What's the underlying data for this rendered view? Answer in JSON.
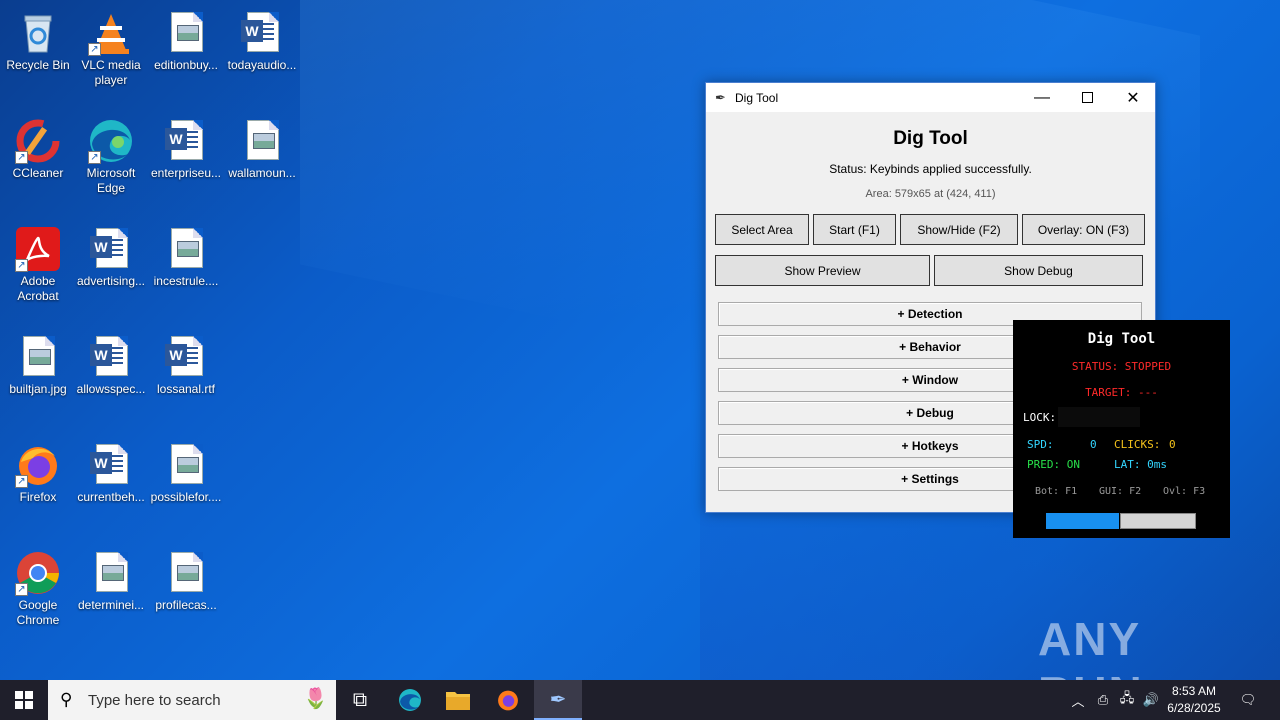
{
  "desktop_icons": [
    {
      "label": "Recycle Bin",
      "icon": "recycle-bin-icon"
    },
    {
      "label": "VLC media player",
      "icon": "vlc-icon"
    },
    {
      "label": "editionbuy...",
      "icon": "image-file-icon"
    },
    {
      "label": "todayaudio...",
      "icon": "word-document-icon"
    },
    {
      "label": "CCleaner",
      "icon": "ccleaner-icon"
    },
    {
      "label": "Microsoft Edge",
      "icon": "edge-icon"
    },
    {
      "label": "enterpriseu...",
      "icon": "word-document-icon"
    },
    {
      "label": "wallamoun...",
      "icon": "image-file-icon"
    },
    {
      "label": "Adobe Acrobat",
      "icon": "acrobat-icon"
    },
    {
      "label": "advertising...",
      "icon": "word-document-icon"
    },
    {
      "label": "incestrule....",
      "icon": "image-file-icon"
    },
    {
      "label": "builtjan.jpg",
      "icon": "image-file-icon"
    },
    {
      "label": "allowsspec...",
      "icon": "word-document-icon"
    },
    {
      "label": "lossanal.rtf",
      "icon": "word-document-icon"
    },
    {
      "label": "Firefox",
      "icon": "firefox-icon"
    },
    {
      "label": "currentbeh...",
      "icon": "word-document-icon"
    },
    {
      "label": "possiblefor....",
      "icon": "image-file-icon"
    },
    {
      "label": "Google Chrome",
      "icon": "chrome-icon"
    },
    {
      "label": "determinei...",
      "icon": "image-file-icon"
    },
    {
      "label": "profilecas...",
      "icon": "image-file-icon"
    }
  ],
  "window": {
    "title": "Dig Tool",
    "heading": "Dig Tool",
    "status": "Status: Keybinds applied successfully.",
    "area": "Area: 579x65 at (424, 411)",
    "buttons": {
      "select_area": "Select Area",
      "start": "Start (F1)",
      "show_hide": "Show/Hide (F2)",
      "overlay": "Overlay: ON (F3)",
      "show_preview": "Show Preview",
      "show_debug": "Show Debug"
    },
    "sections": [
      "+ Detection",
      "+ Behavior",
      "+ Window",
      "+ Debug",
      "+ Hotkeys",
      "+ Settings"
    ]
  },
  "overlay": {
    "title": "Dig Tool",
    "status": "STATUS: STOPPED",
    "target": "TARGET: ---",
    "lock_label": "LOCK:",
    "spd_label": "SPD:",
    "spd_value": "0",
    "clicks_label": "CLICKS:",
    "clicks_value": "0",
    "pred": "PRED: ON",
    "lat": "LAT: 0ms",
    "hotkeys": {
      "bot": "Bot: F1",
      "gui": "GUI: F2",
      "ovl": "Ovl: F3"
    },
    "colors": {
      "status": "#ff2a2a",
      "cyan": "#33d6ff",
      "yellow": "#f4c21b",
      "green": "#28e04a"
    }
  },
  "watermark": "ANY RUN",
  "taskbar": {
    "search_placeholder": "Type here to search",
    "time": "8:53 AM",
    "date": "6/28/2025"
  }
}
